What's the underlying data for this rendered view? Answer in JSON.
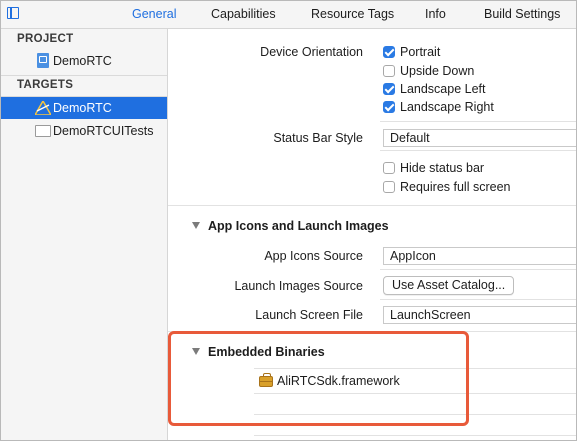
{
  "tabs": [
    "General",
    "Capabilities",
    "Resource Tags",
    "Info",
    "Build Settings"
  ],
  "sidebar": {
    "project_header": "PROJECT",
    "project_item": "DemoRTC",
    "targets_header": "TARGETS",
    "target_items": [
      "DemoRTC",
      "DemoRTCUITests"
    ]
  },
  "deployment": {
    "orientation_label": "Device Orientation",
    "orientations": [
      {
        "label": "Portrait",
        "checked": true
      },
      {
        "label": "Upside Down",
        "checked": false
      },
      {
        "label": "Landscape Left",
        "checked": true
      },
      {
        "label": "Landscape Right",
        "checked": true
      }
    ],
    "status_bar_style_label": "Status Bar Style",
    "status_bar_style_value": "Default",
    "hide_status_bar_label": "Hide status bar",
    "requires_full_screen_label": "Requires full screen"
  },
  "app_icons": {
    "title": "App Icons and Launch Images",
    "icons_source_label": "App Icons Source",
    "icons_source_value": "AppIcon",
    "launch_images_source_label": "Launch Images Source",
    "launch_images_button": "Use Asset Catalog...",
    "launch_screen_file_label": "Launch Screen File",
    "launch_screen_file_value": "LaunchScreen"
  },
  "embedded_binaries": {
    "title": "Embedded Binaries",
    "items": [
      "AliRTCSdk.framework"
    ]
  },
  "colors": {
    "accent": "#1f6fe0",
    "highlight": "#e85a3a"
  }
}
